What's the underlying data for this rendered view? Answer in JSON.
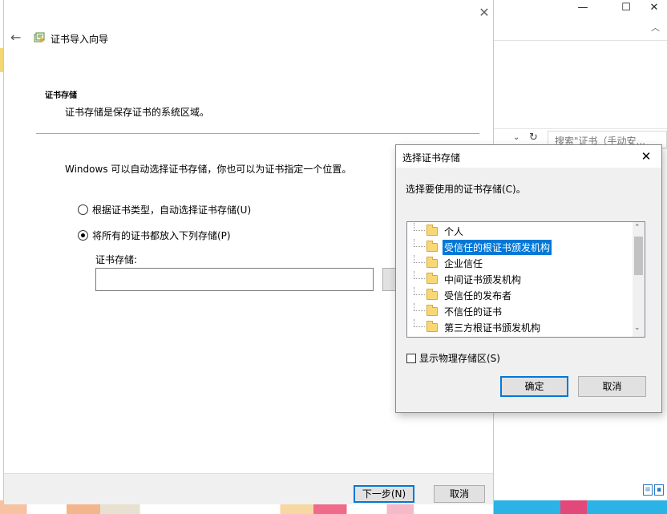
{
  "background_window": {
    "controls": [
      "—",
      "☐",
      "✕"
    ],
    "search_placeholder": "搜索\"证书（手动安..."
  },
  "wizard": {
    "title": "证书导入向导",
    "section_title": "证书存储",
    "section_desc": "证书存储是保存证书的系统区域。",
    "intro": "Windows 可以自动选择证书存储，你也可以为证书指定一个位置。",
    "radio_auto": "根据证书类型，自动选择证书存储(U)",
    "radio_manual": "将所有的证书都放入下列存储(P)",
    "store_label": "证书存储:",
    "store_value": "",
    "next_button": "下一步(N)",
    "cancel_button": "取消"
  },
  "dialog": {
    "title": "选择证书存储",
    "prompt": "选择要使用的证书存储(C)。",
    "stores": [
      {
        "label": "个人",
        "selected": false
      },
      {
        "label": "受信任的根证书颁发机构",
        "selected": true
      },
      {
        "label": "企业信任",
        "selected": false
      },
      {
        "label": "中间证书颁发机构",
        "selected": false
      },
      {
        "label": "受信任的发布者",
        "selected": false
      },
      {
        "label": "不信任的证书",
        "selected": false
      },
      {
        "label": "第三方根证书颁发机构",
        "selected": false
      }
    ],
    "show_physical": "显示物理存储区(S)",
    "show_physical_checked": false,
    "ok_button": "确定",
    "cancel_button": "取消"
  },
  "colors": {
    "selection": "#0078d7",
    "folder": "#f8d775"
  }
}
